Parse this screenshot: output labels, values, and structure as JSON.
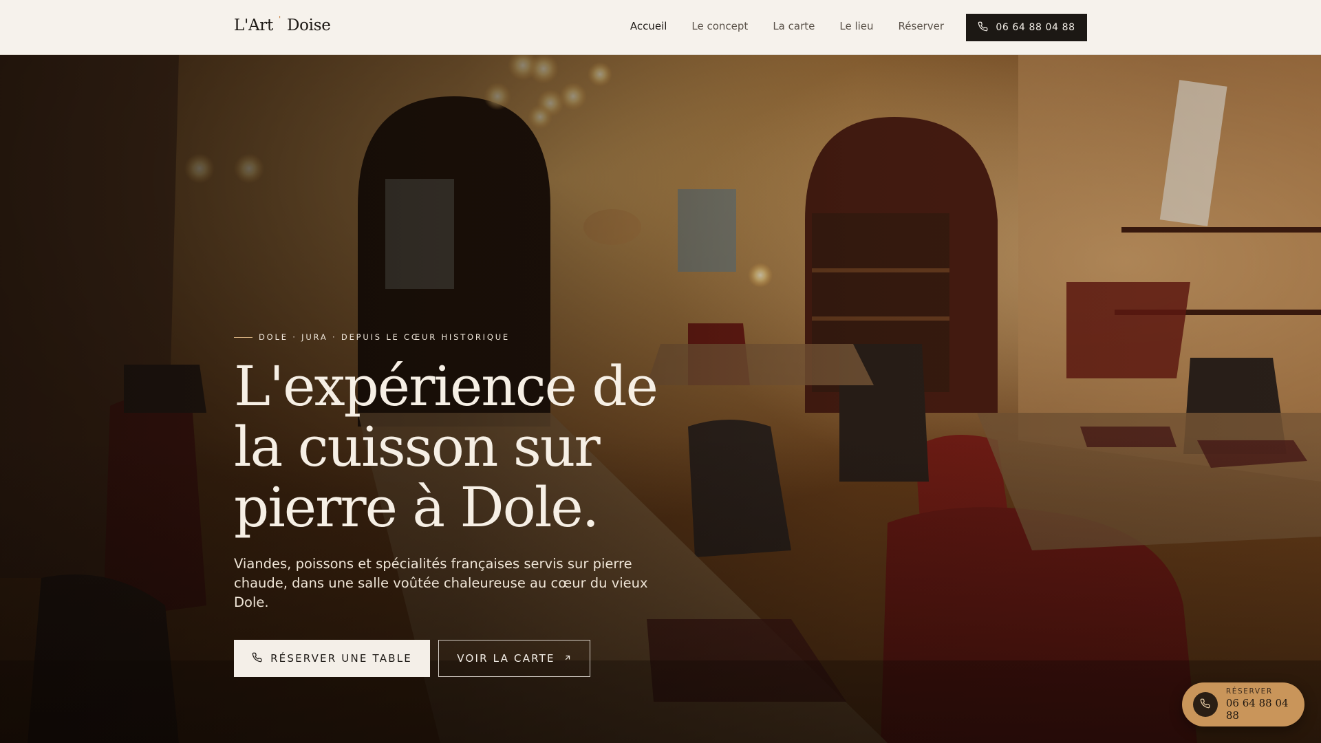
{
  "header": {
    "logo_left": "L'Art",
    "logo_right": "Doise",
    "nav": [
      {
        "label": "Accueil"
      },
      {
        "label": "Le concept"
      },
      {
        "label": "La carte"
      },
      {
        "label": "Le lieu"
      },
      {
        "label": "Réserver"
      }
    ],
    "phone": "06 64 88 04 88"
  },
  "hero": {
    "eyebrow": "DOLE · JURA · DEPUIS LE CŒUR HISTORIQUE",
    "headline": "L'expérience de la cuisson sur pierre à Dole.",
    "lede": "Viandes, poissons et spécialités françaises servis sur pierre chaude, dans une salle voûtée chaleureuse au cœur du vieux Dole.",
    "primary_cta": "RÉSERVER UNE TABLE",
    "secondary_cta": "VOIR LA CARTE"
  },
  "fab": {
    "label": "RÉSERVER",
    "phone": "06 64 88 04 88"
  },
  "colors": {
    "header_bg": "#f6f2ec",
    "dark": "#1c1814",
    "accent": "#c9955a",
    "cream": "#f4efe8"
  },
  "icons": [
    "phone-icon",
    "arrow-up-right-icon"
  ]
}
